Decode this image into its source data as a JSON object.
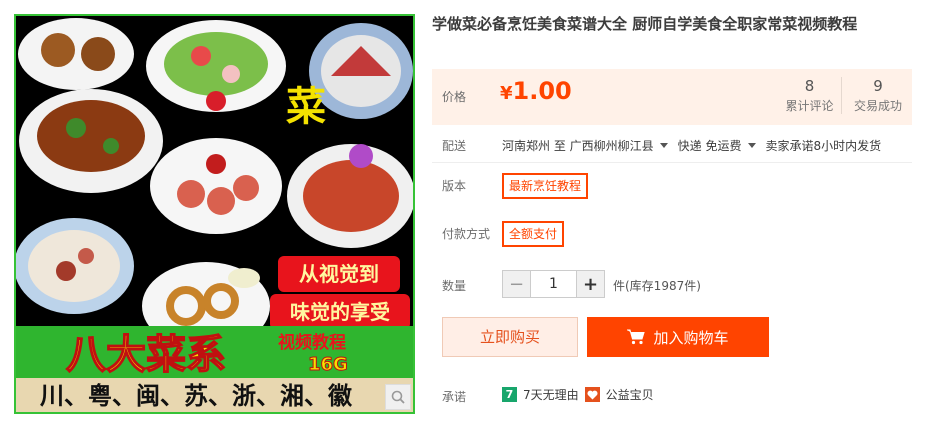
{
  "gallery": {
    "vegetable_char": "菜",
    "slogan_line1": "从视觉到",
    "slogan_line2": "味觉的享受",
    "big_title": "八大菜系",
    "sub_title": "视频教程",
    "size_text": "16G",
    "bottom_text": "川、粤、闽、苏、浙、湘、徽",
    "zoom_icon": "magnifier-icon"
  },
  "product": {
    "title": "学做菜必备烹饪美食菜谱大全 厨师自学美食全职家常菜视频教程"
  },
  "price": {
    "label": "价格",
    "currency": "¥",
    "amount": "1.00",
    "reviews_count": "8",
    "reviews_label": "累计评论",
    "deals_count": "9",
    "deals_label": "交易成功"
  },
  "delivery": {
    "label": "配送",
    "from": "河南郑州 至",
    "to": "广西柳州柳江县",
    "method": "快递 免运费",
    "promise": "卖家承诺8小时内发货"
  },
  "options": {
    "version_label": "版本",
    "version_value": "最新烹饪教程",
    "payment_label": "付款方式",
    "payment_value": "全额支付"
  },
  "quantity": {
    "label": "数量",
    "minus": "−",
    "value": "1",
    "plus": "+",
    "stock": "件(库存1987件)"
  },
  "actions": {
    "buy_now": "立即购买",
    "add_to_cart": "加入购物车",
    "cart_icon": "cart-icon"
  },
  "promise": {
    "label": "承诺",
    "badge_text": "7",
    "return_policy": "7天无理由",
    "charity": "公益宝贝"
  },
  "colors": {
    "accent": "#ff4400",
    "price_bg": "#fff1e8",
    "image_border": "#36c236"
  }
}
